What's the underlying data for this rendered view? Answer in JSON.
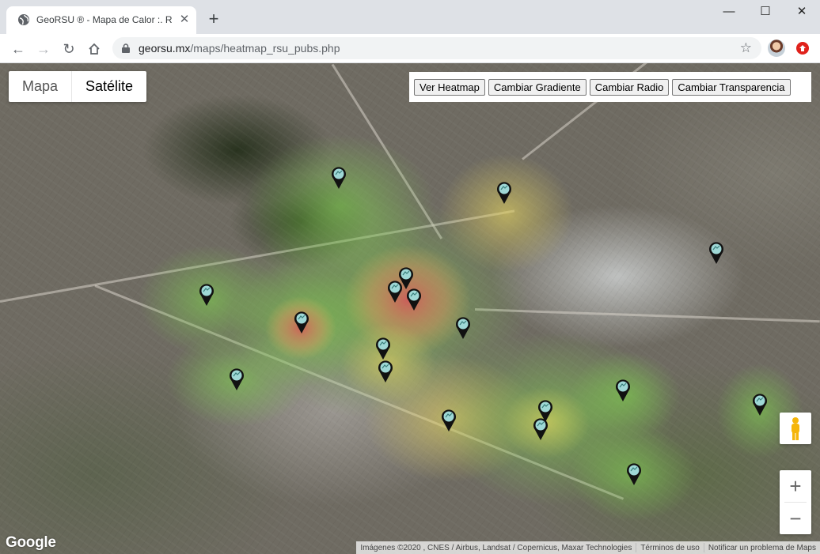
{
  "browser": {
    "tab_title": "GeoRSU ® - Mapa de Calor :. Re",
    "url_host": "georsu.mx",
    "url_path": "/maps/heatmap_rsu_pubs.php",
    "window_controls": {
      "minimize": "—",
      "maximize": "☐",
      "close": "✕"
    },
    "new_tab": "+",
    "icons": [
      "globe-icon",
      "close-icon",
      "back-icon",
      "forward-icon",
      "reload-icon",
      "home-icon",
      "lock-icon",
      "star-icon",
      "avatar",
      "extension-icon"
    ]
  },
  "map": {
    "type_controls": [
      {
        "label": "Mapa",
        "active": false
      },
      {
        "label": "Satélite",
        "active": true
      }
    ],
    "buttons": [
      "Ver Heatmap",
      "Cambiar Gradiente",
      "Cambiar Radio",
      "Cambiar Transparencia"
    ],
    "zoom_in": "+",
    "zoom_out": "−",
    "google_logo": "Google",
    "attribution": {
      "imagery": "Imágenes ©2020 , CNES / Airbus, Landsat / Copernicus, Maxar Technologies",
      "terms": "Términos de uso",
      "report": "Notificar un problema de Maps"
    },
    "marker_count": 19,
    "colors": {
      "heat_low": "#7ec850",
      "heat_mid": "#e0d060",
      "heat_high": "#e0505a",
      "marker": "#111111",
      "marker_center": "#9fd8d6"
    }
  }
}
